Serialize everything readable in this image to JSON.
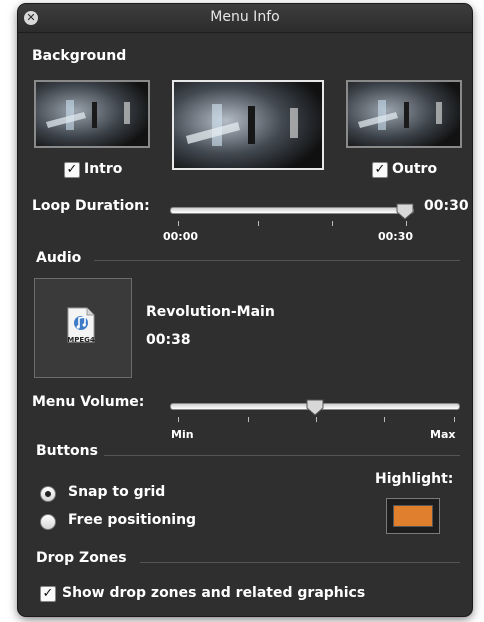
{
  "window": {
    "title": "Menu Info"
  },
  "background": {
    "section_label": "Background",
    "thumbs": [
      {
        "name": "intro",
        "checked": true,
        "label": "Intro"
      },
      {
        "name": "main"
      },
      {
        "name": "outro",
        "checked": true,
        "label": "Outro"
      }
    ]
  },
  "loop_duration": {
    "label": "Loop Duration:",
    "value": "00:30",
    "ticks": {
      "start": "00:00",
      "end": "00:30"
    },
    "position": 1.0
  },
  "audio": {
    "section_label": "Audio",
    "file_badge": "MPEG4",
    "track_name": "Revolution-Main",
    "track_duration": "00:38"
  },
  "menu_volume": {
    "label": "Menu Volume:",
    "min_label": "Min",
    "max_label": "Max",
    "position": 0.5
  },
  "buttons": {
    "section_label": "Buttons",
    "snap_label": "Snap to grid",
    "free_label": "Free positioning",
    "selected": "snap",
    "highlight_label": "Highlight:",
    "highlight_color": "#e07f2e"
  },
  "drop_zones": {
    "section_label": "Drop Zones",
    "show_label": "Show drop zones and related graphics",
    "checked": true
  },
  "colors": {
    "panel_bg": "#2f2f2f",
    "text": "#ffffff",
    "separator": "#555555"
  }
}
